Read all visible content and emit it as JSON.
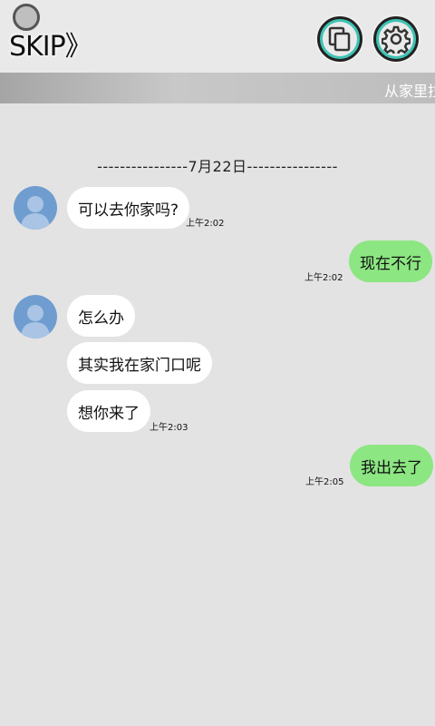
{
  "header": {
    "skip_label": "SKIP",
    "skip_arrow": "》",
    "copy_button_icon": "copy-icon",
    "settings_button_icon": "gear-icon"
  },
  "banner": {
    "text": "从家里拉"
  },
  "chat": {
    "date_divider": "----------------7月22日----------------",
    "messages": [
      {
        "side": "in",
        "text": "可以去你家吗?",
        "time": "上午2:02"
      },
      {
        "side": "out",
        "text": "现在不行",
        "time": "上午2:02"
      },
      {
        "side": "in",
        "text": "怎么办",
        "time": ""
      },
      {
        "side": "in",
        "text": "其实我在家门口呢",
        "time": ""
      },
      {
        "side": "in",
        "text": "想你来了",
        "time": "上午2:03"
      },
      {
        "side": "out",
        "text": "我出去了",
        "time": "上午2:05"
      }
    ]
  },
  "colors": {
    "accent_teal": "#3fc3b3",
    "outgoing_bubble": "#8ce682",
    "incoming_bubble": "#ffffff",
    "avatar": "#6f9dcf"
  }
}
